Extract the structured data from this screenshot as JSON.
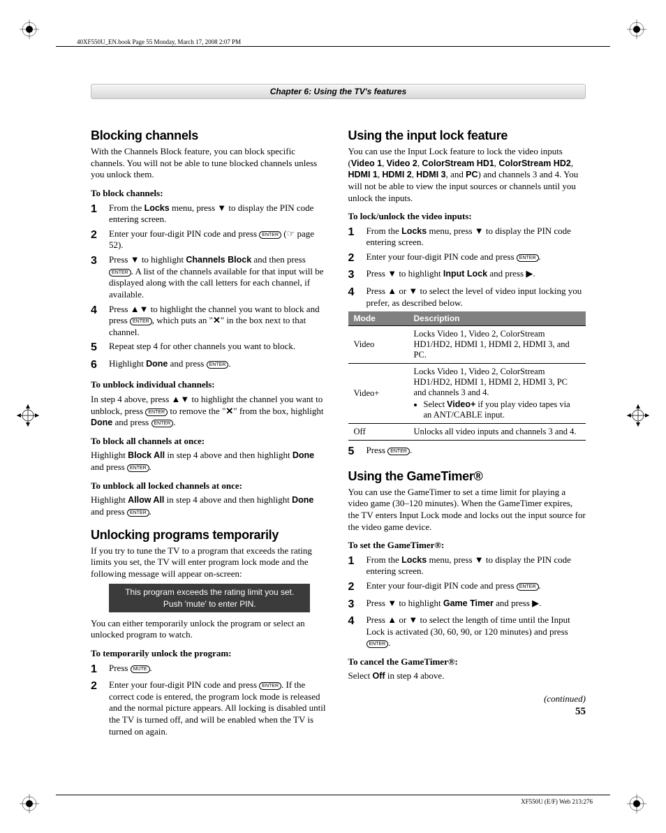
{
  "header_line": "40XF550U_EN.book  Page 55  Monday, March 17, 2008  2:07 PM",
  "chapter_title": "Chapter 6: Using the TV's features",
  "left": {
    "h_blocking": "Blocking channels",
    "blocking_intro": "With the Channels Block feature, you can block specific channels. You will not be able to tune blocked channels unless you unlock them.",
    "sub_block": "To block channels:",
    "step1a": "From the ",
    "step1b": "Locks",
    "step1c": " menu, press ▼ to display the PIN code entering screen.",
    "step2a": "Enter your four-digit PIN code and press ",
    "step2b": " (☞ page 52).",
    "step3a": "Press ▼ to highlight ",
    "step3b": "Channels Block",
    "step3c": " and then press ",
    "step3d": ". A list of the channels available for that input will be displayed along with the call letters for each channel, if available.",
    "step4a": "Press ▲▼ to highlight the channel you want to block and press ",
    "step4b": ", which puts an \"",
    "step4c": "✕",
    "step4d": "\" in the box next to that channel.",
    "step5": "Repeat step 4 for other channels you want to block.",
    "step6a": "Highlight ",
    "step6b": "Done",
    "step6c": " and press ",
    "sub_unblock_ind": "To unblock individual channels:",
    "unblock_ind_a": "In step 4 above, press ▲▼ to highlight the channel you want to unblock, press ",
    "unblock_ind_b": " to remove the \"",
    "unblock_ind_c": "✕",
    "unblock_ind_d": "\" from the box, highlight ",
    "unblock_ind_e": "Done",
    "unblock_ind_f": " and press ",
    "sub_block_all": "To block all channels at once:",
    "block_all_a": "Highlight ",
    "block_all_b": "Block All",
    "block_all_c": " in step 4 above and then highlight ",
    "block_all_d": "Done",
    "block_all_e": " and press ",
    "sub_unblock_all": "To unblock all locked channels at once:",
    "unblock_all_a": "Highlight ",
    "unblock_all_b": "Allow All",
    "unblock_all_c": " in step 4 above and then highlight ",
    "unblock_all_d": "Done",
    "unblock_all_e": " and press ",
    "h_unlock": "Unlocking programs temporarily",
    "unlock_intro": "If you try to tune the TV to a program that exceeds the rating limits you set, the TV will enter program lock mode and the following message will appear on-screen:",
    "msg_line1": "This program exceeds the rating limit you set.",
    "msg_line2": "Push 'mute' to enter PIN.",
    "unlock_after": "You can either temporarily unlock the program or select an unlocked program to watch.",
    "sub_temp_unlock": "To temporarily unlock the program:",
    "tstep1a": "Press ",
    "tstep2a": "Enter your four-digit PIN code and press ",
    "tstep2b": ". If the correct code is entered, the program lock mode is released and the normal picture appears. All locking is disabled until the TV is turned off, and will be enabled when the TV is turned on again."
  },
  "right": {
    "h_input": "Using the input lock feature",
    "input_intro_a": "You can use the Input Lock feature to lock the video inputs (",
    "input_intro_list": [
      "Video 1",
      "Video 2",
      "ColorStream HD1",
      "ColorStream HD2",
      "HDMI 1",
      "HDMI 2",
      "HDMI 3",
      "PC"
    ],
    "input_intro_b": ") and channels 3 and 4. You will not be able to view the input sources or channels until you unlock the inputs.",
    "sub_lock": "To lock/unlock the video inputs:",
    "istep1a": "From the ",
    "istep1b": "Locks",
    "istep1c": " menu, press ▼ to display the PIN code entering screen.",
    "istep2": "Enter your four-digit PIN code and press ",
    "istep3a": "Press ▼ to highlight ",
    "istep3b": "Input Lock",
    "istep3c": " and press ▶.",
    "istep4": "Press ▲ or ▼ to select the level of video input locking you prefer, as described below.",
    "table": {
      "h1": "Mode",
      "h2": "Description",
      "r1m": "Video",
      "r1d": "Locks Video 1, Video 2, ColorStream HD1/HD2, HDMI 1, HDMI 2, HDMI 3, and PC.",
      "r2m": "Video+",
      "r2d": "Locks Video 1, Video 2, ColorStream HD1/HD2, HDMI 1, HDMI 2, HDMI 3, PC and channels 3 and 4.",
      "r2bullet_a": "Select ",
      "r2bullet_b": "Video+",
      "r2bullet_c": " if you play video tapes via an ANT/CABLE input.",
      "r3m": "Off",
      "r3d": "Unlocks all video inputs and channels 3 and 4."
    },
    "istep5": "Press ",
    "h_gametimer": "Using the GameTimer®",
    "gt_intro": "You can use the GameTimer to set a time limit for playing a video game (30–120 minutes). When the GameTimer expires, the TV enters Input Lock mode and locks out the input source for the video game device.",
    "sub_set_gt": "To set the GameTimer®:",
    "gstep1a": "From the ",
    "gstep1b": "Locks",
    "gstep1c": " menu, press ▼ to display the PIN code entering screen.",
    "gstep2": "Enter your four-digit PIN code and press ",
    "gstep3a": "Press ▼ to highlight ",
    "gstep3b": "Game Timer",
    "gstep3c": " and press ▶.",
    "gstep4": "Press ▲ or ▼ to select the length of time until the Input Lock is activated (30, 60, 90, or 120 minutes) and press ",
    "sub_cancel_gt": "To cancel the GameTimer®:",
    "cancel_gt_a": "Select ",
    "cancel_gt_b": "Off",
    "cancel_gt_c": " in step 4 above."
  },
  "continued": "(continued)",
  "pagenum": "55",
  "footer": "XF550U (E/F) Web 213:276"
}
